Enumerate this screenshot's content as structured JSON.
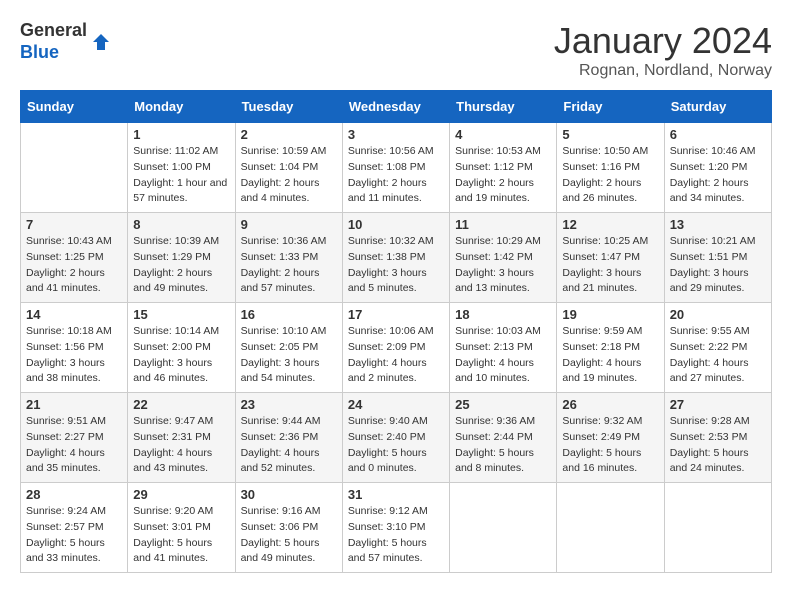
{
  "logo": {
    "general": "General",
    "blue": "Blue"
  },
  "header": {
    "month": "January 2024",
    "location": "Rognan, Nordland, Norway"
  },
  "weekdays": [
    "Sunday",
    "Monday",
    "Tuesday",
    "Wednesday",
    "Thursday",
    "Friday",
    "Saturday"
  ],
  "weeks": [
    [
      {
        "day": "",
        "info": ""
      },
      {
        "day": "1",
        "info": "Sunrise: 11:02 AM\nSunset: 1:00 PM\nDaylight: 1 hour and 57 minutes."
      },
      {
        "day": "2",
        "info": "Sunrise: 10:59 AM\nSunset: 1:04 PM\nDaylight: 2 hours and 4 minutes."
      },
      {
        "day": "3",
        "info": "Sunrise: 10:56 AM\nSunset: 1:08 PM\nDaylight: 2 hours and 11 minutes."
      },
      {
        "day": "4",
        "info": "Sunrise: 10:53 AM\nSunset: 1:12 PM\nDaylight: 2 hours and 19 minutes."
      },
      {
        "day": "5",
        "info": "Sunrise: 10:50 AM\nSunset: 1:16 PM\nDaylight: 2 hours and 26 minutes."
      },
      {
        "day": "6",
        "info": "Sunrise: 10:46 AM\nSunset: 1:20 PM\nDaylight: 2 hours and 34 minutes."
      }
    ],
    [
      {
        "day": "7",
        "info": "Sunrise: 10:43 AM\nSunset: 1:25 PM\nDaylight: 2 hours and 41 minutes."
      },
      {
        "day": "8",
        "info": "Sunrise: 10:39 AM\nSunset: 1:29 PM\nDaylight: 2 hours and 49 minutes."
      },
      {
        "day": "9",
        "info": "Sunrise: 10:36 AM\nSunset: 1:33 PM\nDaylight: 2 hours and 57 minutes."
      },
      {
        "day": "10",
        "info": "Sunrise: 10:32 AM\nSunset: 1:38 PM\nDaylight: 3 hours and 5 minutes."
      },
      {
        "day": "11",
        "info": "Sunrise: 10:29 AM\nSunset: 1:42 PM\nDaylight: 3 hours and 13 minutes."
      },
      {
        "day": "12",
        "info": "Sunrise: 10:25 AM\nSunset: 1:47 PM\nDaylight: 3 hours and 21 minutes."
      },
      {
        "day": "13",
        "info": "Sunrise: 10:21 AM\nSunset: 1:51 PM\nDaylight: 3 hours and 29 minutes."
      }
    ],
    [
      {
        "day": "14",
        "info": "Sunrise: 10:18 AM\nSunset: 1:56 PM\nDaylight: 3 hours and 38 minutes."
      },
      {
        "day": "15",
        "info": "Sunrise: 10:14 AM\nSunset: 2:00 PM\nDaylight: 3 hours and 46 minutes."
      },
      {
        "day": "16",
        "info": "Sunrise: 10:10 AM\nSunset: 2:05 PM\nDaylight: 3 hours and 54 minutes."
      },
      {
        "day": "17",
        "info": "Sunrise: 10:06 AM\nSunset: 2:09 PM\nDaylight: 4 hours and 2 minutes."
      },
      {
        "day": "18",
        "info": "Sunrise: 10:03 AM\nSunset: 2:13 PM\nDaylight: 4 hours and 10 minutes."
      },
      {
        "day": "19",
        "info": "Sunrise: 9:59 AM\nSunset: 2:18 PM\nDaylight: 4 hours and 19 minutes."
      },
      {
        "day": "20",
        "info": "Sunrise: 9:55 AM\nSunset: 2:22 PM\nDaylight: 4 hours and 27 minutes."
      }
    ],
    [
      {
        "day": "21",
        "info": "Sunrise: 9:51 AM\nSunset: 2:27 PM\nDaylight: 4 hours and 35 minutes."
      },
      {
        "day": "22",
        "info": "Sunrise: 9:47 AM\nSunset: 2:31 PM\nDaylight: 4 hours and 43 minutes."
      },
      {
        "day": "23",
        "info": "Sunrise: 9:44 AM\nSunset: 2:36 PM\nDaylight: 4 hours and 52 minutes."
      },
      {
        "day": "24",
        "info": "Sunrise: 9:40 AM\nSunset: 2:40 PM\nDaylight: 5 hours and 0 minutes."
      },
      {
        "day": "25",
        "info": "Sunrise: 9:36 AM\nSunset: 2:44 PM\nDaylight: 5 hours and 8 minutes."
      },
      {
        "day": "26",
        "info": "Sunrise: 9:32 AM\nSunset: 2:49 PM\nDaylight: 5 hours and 16 minutes."
      },
      {
        "day": "27",
        "info": "Sunrise: 9:28 AM\nSunset: 2:53 PM\nDaylight: 5 hours and 24 minutes."
      }
    ],
    [
      {
        "day": "28",
        "info": "Sunrise: 9:24 AM\nSunset: 2:57 PM\nDaylight: 5 hours and 33 minutes."
      },
      {
        "day": "29",
        "info": "Sunrise: 9:20 AM\nSunset: 3:01 PM\nDaylight: 5 hours and 41 minutes."
      },
      {
        "day": "30",
        "info": "Sunrise: 9:16 AM\nSunset: 3:06 PM\nDaylight: 5 hours and 49 minutes."
      },
      {
        "day": "31",
        "info": "Sunrise: 9:12 AM\nSunset: 3:10 PM\nDaylight: 5 hours and 57 minutes."
      },
      {
        "day": "",
        "info": ""
      },
      {
        "day": "",
        "info": ""
      },
      {
        "day": "",
        "info": ""
      }
    ]
  ]
}
